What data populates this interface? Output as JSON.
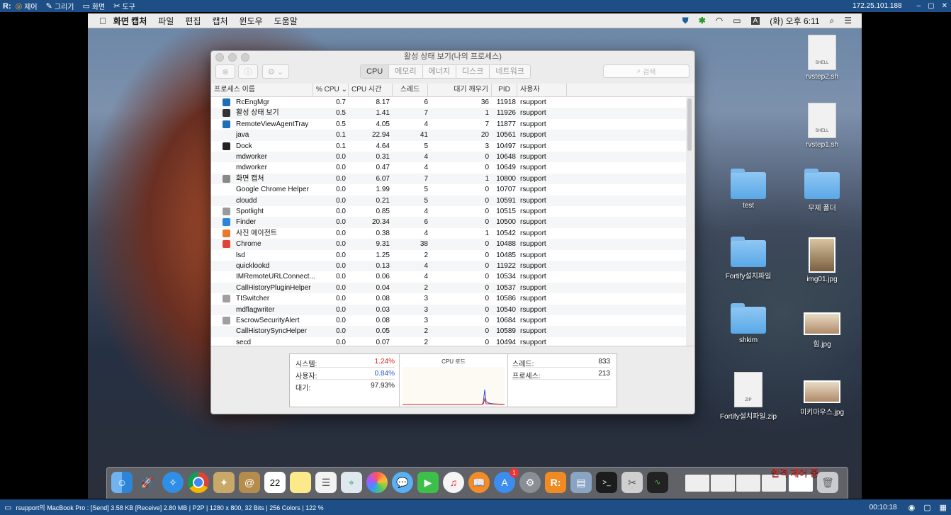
{
  "remote_toolbar": {
    "logo": "R:",
    "items": [
      {
        "icon": "target-icon",
        "glyph": "◎",
        "label": "제어"
      },
      {
        "icon": "pencil-icon",
        "glyph": "✎",
        "label": "그리기"
      },
      {
        "icon": "monitor-icon",
        "glyph": "▭",
        "label": "화면"
      },
      {
        "icon": "tools-icon",
        "glyph": "✂",
        "label": "도구"
      }
    ],
    "ip": "172.25.101.188",
    "window_controls": [
      "–",
      "▢",
      "✕"
    ]
  },
  "mac_menubar": {
    "apple": "",
    "menus": [
      "화면 캡처",
      "파일",
      "편집",
      "캡처",
      "윈도우",
      "도움말"
    ],
    "clock": "(화) 오후 6:11",
    "input_indicator": "A"
  },
  "window": {
    "title": "활성 상태 보기(나의 프로세스)",
    "tabs": [
      "CPU",
      "메모리",
      "에너지",
      "디스크",
      "네트워크"
    ],
    "active_tab": "CPU",
    "search_placeholder": "검색",
    "columns": [
      "프로세스 이름",
      "% CPU",
      "CPU 시간",
      "스레드",
      "대기 깨우기",
      "PID",
      "사용자"
    ],
    "sort_indicator": "⌄",
    "rows": [
      {
        "name": "RcEngMgr",
        "cpu": "0.7",
        "time": "8.17",
        "threads": "6",
        "wakeups": "36",
        "pid": "11918",
        "user": "rsupport",
        "icon": "#1f6fb8"
      },
      {
        "name": "활성 상태 보기",
        "cpu": "0.5",
        "time": "1.41",
        "threads": "7",
        "wakeups": "1",
        "pid": "11926",
        "user": "rsupport",
        "icon": "#333333"
      },
      {
        "name": "RemoteViewAgentTray",
        "cpu": "0.5",
        "time": "4.05",
        "threads": "4",
        "wakeups": "7",
        "pid": "11877",
        "user": "rsupport",
        "icon": "#1f6fb8"
      },
      {
        "name": "java",
        "cpu": "0.1",
        "time": "22.94",
        "threads": "41",
        "wakeups": "20",
        "pid": "10561",
        "user": "rsupport",
        "icon": ""
      },
      {
        "name": "Dock",
        "cpu": "0.1",
        "time": "4.64",
        "threads": "5",
        "wakeups": "3",
        "pid": "10497",
        "user": "rsupport",
        "icon": "#222222"
      },
      {
        "name": "mdworker",
        "cpu": "0.0",
        "time": "0.31",
        "threads": "4",
        "wakeups": "0",
        "pid": "10648",
        "user": "rsupport",
        "icon": ""
      },
      {
        "name": "mdworker",
        "cpu": "0.0",
        "time": "0.47",
        "threads": "4",
        "wakeups": "0",
        "pid": "10649",
        "user": "rsupport",
        "icon": ""
      },
      {
        "name": "화면 캡처",
        "cpu": "0.0",
        "time": "6.07",
        "threads": "7",
        "wakeups": "1",
        "pid": "10800",
        "user": "rsupport",
        "icon": "#888888"
      },
      {
        "name": "Google Chrome Helper",
        "cpu": "0.0",
        "time": "1.99",
        "threads": "5",
        "wakeups": "0",
        "pid": "10707",
        "user": "rsupport",
        "icon": ""
      },
      {
        "name": "cloudd",
        "cpu": "0.0",
        "time": "0.21",
        "threads": "5",
        "wakeups": "0",
        "pid": "10591",
        "user": "rsupport",
        "icon": ""
      },
      {
        "name": "Spotlight",
        "cpu": "0.0",
        "time": "0.85",
        "threads": "4",
        "wakeups": "0",
        "pid": "10515",
        "user": "rsupport",
        "icon": "#9a9a9a"
      },
      {
        "name": "Finder",
        "cpu": "0.0",
        "time": "20.34",
        "threads": "6",
        "wakeups": "0",
        "pid": "10500",
        "user": "rsupport",
        "icon": "#2d84d8"
      },
      {
        "name": "사진 에이전트",
        "cpu": "0.0",
        "time": "0.38",
        "threads": "4",
        "wakeups": "1",
        "pid": "10542",
        "user": "rsupport",
        "icon": "#e97a2c"
      },
      {
        "name": "Chrome",
        "cpu": "0.0",
        "time": "9.31",
        "threads": "38",
        "wakeups": "0",
        "pid": "10488",
        "user": "rsupport",
        "icon": "#db4437"
      },
      {
        "name": "lsd",
        "cpu": "0.0",
        "time": "1.25",
        "threads": "2",
        "wakeups": "0",
        "pid": "10485",
        "user": "rsupport",
        "icon": ""
      },
      {
        "name": "quicklookd",
        "cpu": "0.0",
        "time": "0.13",
        "threads": "4",
        "wakeups": "0",
        "pid": "11922",
        "user": "rsupport",
        "icon": ""
      },
      {
        "name": "IMRemoteURLConnect...",
        "cpu": "0.0",
        "time": "0.06",
        "threads": "4",
        "wakeups": "0",
        "pid": "10534",
        "user": "rsupport",
        "icon": ""
      },
      {
        "name": "CallHistoryPluginHelper",
        "cpu": "0.0",
        "time": "0.04",
        "threads": "2",
        "wakeups": "0",
        "pid": "10537",
        "user": "rsupport",
        "icon": ""
      },
      {
        "name": "TISwitcher",
        "cpu": "0.0",
        "time": "0.08",
        "threads": "3",
        "wakeups": "0",
        "pid": "10586",
        "user": "rsupport",
        "icon": "#a0a0a0"
      },
      {
        "name": "mdflagwriter",
        "cpu": "0.0",
        "time": "0.03",
        "threads": "3",
        "wakeups": "0",
        "pid": "10540",
        "user": "rsupport",
        "icon": ""
      },
      {
        "name": "EscrowSecurityAlert",
        "cpu": "0.0",
        "time": "0.08",
        "threads": "3",
        "wakeups": "0",
        "pid": "10684",
        "user": "rsupport",
        "icon": "#a0a0a0"
      },
      {
        "name": "CallHistorySyncHelper",
        "cpu": "0.0",
        "time": "0.05",
        "threads": "2",
        "wakeups": "0",
        "pid": "10589",
        "user": "rsupport",
        "icon": ""
      },
      {
        "name": "secd",
        "cpu": "0.0",
        "time": "0.07",
        "threads": "2",
        "wakeups": "0",
        "pid": "10494",
        "user": "rsupport",
        "icon": ""
      }
    ],
    "summary": {
      "system_label": "시스템:",
      "system_value": "1.24%",
      "system_color": "#e02020",
      "user_label": "사용자:",
      "user_value": "0.84%",
      "user_color": "#2a52d8",
      "idle_label": "대기:",
      "idle_value": "97.93%",
      "cpu_load_label": "CPU 로드",
      "threads_label": "스레드:",
      "threads_value": "833",
      "processes_label": "프로세스:",
      "processes_value": "213"
    }
  },
  "desktop_icons": [
    {
      "name": "rvstep2.sh",
      "kind": "file",
      "tag": "SHELL"
    },
    {
      "name": "rvstep1.sh",
      "kind": "file",
      "tag": "SHELL"
    },
    {
      "name": "test",
      "kind": "folder"
    },
    {
      "name": "무제 폴더",
      "kind": "folder"
    },
    {
      "name": "Fortify설치파일",
      "kind": "folder"
    },
    {
      "name": "img01.jpg",
      "kind": "photo"
    },
    {
      "name": "shkim",
      "kind": "folder"
    },
    {
      "name": "힘.jpg",
      "kind": "photo-wide"
    },
    {
      "name": "Fortify설치파일.zip",
      "kind": "file",
      "tag": "ZIP"
    },
    {
      "name": "미키마우스.jpg",
      "kind": "photo-wide"
    }
  ],
  "dock": {
    "calendar_day": "22",
    "badge": "1",
    "caption": "원격 제어 중"
  },
  "status_bar": {
    "text": "rsupport의 MacBook Pro : [Send] 3.58 KB  [Receive] 2.80 MB | P2P | 1280 x 800, 32 Bits | 256 Colors | 122 %",
    "time": "00:10:18"
  }
}
